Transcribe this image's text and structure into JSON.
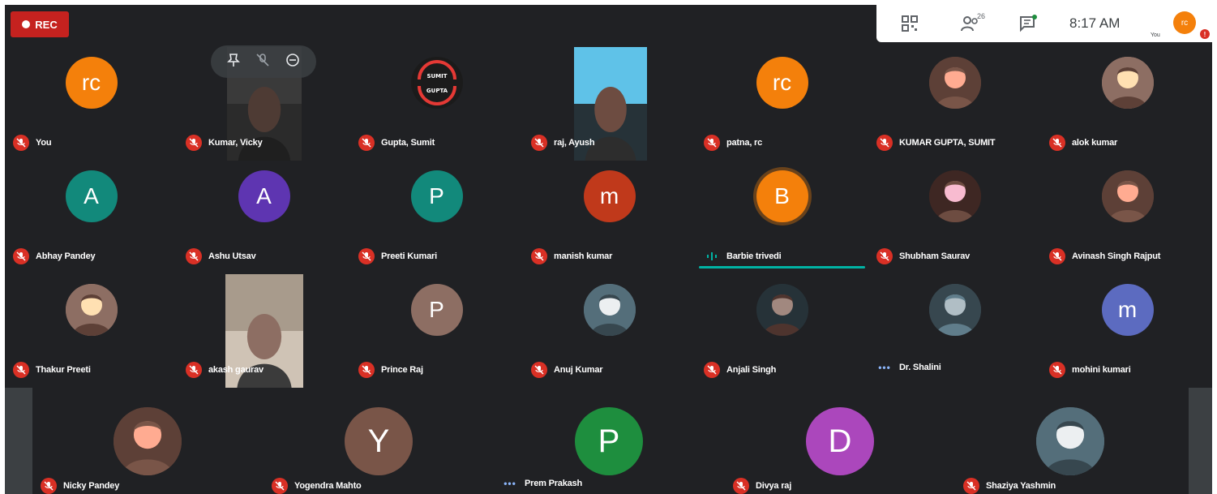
{
  "recording": {
    "label": "REC"
  },
  "topbar": {
    "participants_count": "26",
    "time": "8:17 AM",
    "you_label": "You",
    "avatar_initials": "rc",
    "alert_badge": "!"
  },
  "self_video_controls": {
    "icons": [
      "pin-icon",
      "mic-off-icon",
      "remove-icon"
    ]
  },
  "colors": {
    "background": "#202124",
    "mute_red": "#d93025",
    "rec_red": "#c5221f",
    "speaking_teal": "#00b3a4"
  },
  "participants": [
    {
      "name": "You",
      "initial": "rc",
      "avatar_color": "#f4800b",
      "status": "muted"
    },
    {
      "name": "Kumar, Vicky",
      "initial": "",
      "avatar_color": "",
      "status": "muted"
    },
    {
      "name": "Gupta, Sumit",
      "initial": "",
      "avatar_color": "",
      "status": "muted",
      "logo_text_1": "SUMIT",
      "logo_text_2": "GUPTA"
    },
    {
      "name": "raj, Ayush",
      "initial": "",
      "avatar_color": "",
      "status": "muted"
    },
    {
      "name": "patna, rc",
      "initial": "rc",
      "avatar_color": "#f4800b",
      "status": "muted"
    },
    {
      "name": "KUMAR GUPTA, SUMIT",
      "initial": "",
      "avatar_color": "",
      "status": "muted"
    },
    {
      "name": "alok kumar",
      "initial": "",
      "avatar_color": "",
      "status": "muted"
    },
    {
      "name": "Abhay Pandey",
      "initial": "A",
      "avatar_color": "#12897b",
      "status": "muted"
    },
    {
      "name": "Ashu Utsav",
      "initial": "A",
      "avatar_color": "#5e35b1",
      "status": "muted"
    },
    {
      "name": "Preeti Kumari",
      "initial": "P",
      "avatar_color": "#12897b",
      "status": "muted"
    },
    {
      "name": "manish kumar",
      "initial": "m",
      "avatar_color": "#c0391b",
      "status": "muted"
    },
    {
      "name": "Barbie trivedi",
      "initial": "B",
      "avatar_color": "#f4800b",
      "status": "speaking"
    },
    {
      "name": "Shubham Saurav",
      "initial": "",
      "avatar_color": "",
      "status": "muted"
    },
    {
      "name": "Avinash Singh Rajput",
      "initial": "",
      "avatar_color": "",
      "status": "muted"
    },
    {
      "name": "Thakur Preeti",
      "initial": "",
      "avatar_color": "",
      "status": "muted"
    },
    {
      "name": "akash gaurav",
      "initial": "",
      "avatar_color": "",
      "status": "muted"
    },
    {
      "name": "Prince Raj",
      "initial": "P",
      "avatar_color": "#8d6e63",
      "status": "muted"
    },
    {
      "name": "Anuj Kumar",
      "initial": "",
      "avatar_color": "",
      "status": "muted"
    },
    {
      "name": "Anjali Singh",
      "initial": "",
      "avatar_color": "",
      "status": "muted"
    },
    {
      "name": "Dr. Shalini",
      "initial": "",
      "avatar_color": "",
      "status": "idle"
    },
    {
      "name": "mohini kumari",
      "initial": "m",
      "avatar_color": "#5c6bc0",
      "status": "muted"
    },
    {
      "name": "Nicky Pandey",
      "initial": "",
      "avatar_color": "",
      "status": "muted"
    },
    {
      "name": "Yogendra Mahto",
      "initial": "Y",
      "avatar_color": "#795548",
      "status": "muted"
    },
    {
      "name": "Prem Prakash",
      "initial": "P",
      "avatar_color": "#1e8e3e",
      "status": "idle"
    },
    {
      "name": "Divya raj",
      "initial": "D",
      "avatar_color": "#ab47bc",
      "status": "muted"
    },
    {
      "name": "Shaziya Yashmin",
      "initial": "",
      "avatar_color": "",
      "status": "muted"
    }
  ]
}
